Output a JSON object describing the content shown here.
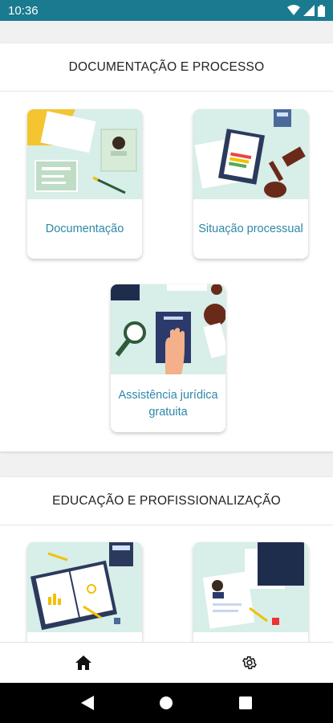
{
  "status_bar": {
    "time": "10:36"
  },
  "sections": [
    {
      "title": "DOCUMENTAÇÃO E PROCESSO",
      "cards": [
        {
          "label": "Documentação"
        },
        {
          "label": "Situação processual"
        },
        {
          "label": "Assistência jurídica gratuita"
        }
      ]
    },
    {
      "title": "EDUCAÇÃO E PROFISSIONALIZAÇÃO",
      "cards": [
        {
          "label": ""
        },
        {
          "label": ""
        }
      ]
    }
  ],
  "bottom_nav": {
    "items": [
      {
        "icon": "home-icon",
        "active": true
      },
      {
        "icon": "gear-icon",
        "active": false
      }
    ]
  },
  "colors": {
    "status_bar": "#1a7a8f",
    "card_label": "#2d88a8",
    "card_art_bg": "#d7eee9"
  }
}
